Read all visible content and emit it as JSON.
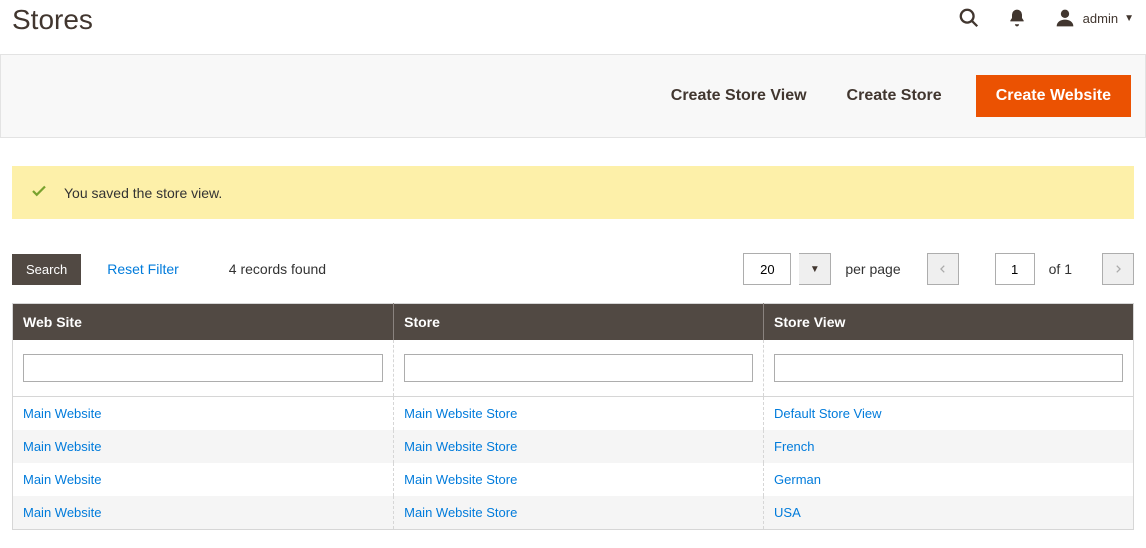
{
  "page": {
    "title": "Stores"
  },
  "header": {
    "user_label": "admin"
  },
  "actions": {
    "create_store_view": "Create Store View",
    "create_store": "Create Store",
    "create_website": "Create Website"
  },
  "message": {
    "text": "You saved the store view."
  },
  "grid_controls": {
    "search_label": "Search",
    "reset_filter_label": "Reset Filter",
    "records_found": "4 records found",
    "per_page_value": "20",
    "per_page_label": "per page",
    "page_value": "1",
    "page_of": "of 1"
  },
  "columns": {
    "website": "Web Site",
    "store": "Store",
    "store_view": "Store View"
  },
  "rows": [
    {
      "website": "Main Website",
      "store": "Main Website Store",
      "store_view": "Default Store View"
    },
    {
      "website": "Main Website",
      "store": "Main Website Store",
      "store_view": "French"
    },
    {
      "website": "Main Website",
      "store": "Main Website Store",
      "store_view": "German"
    },
    {
      "website": "Main Website",
      "store": "Main Website Store",
      "store_view": "USA"
    }
  ]
}
